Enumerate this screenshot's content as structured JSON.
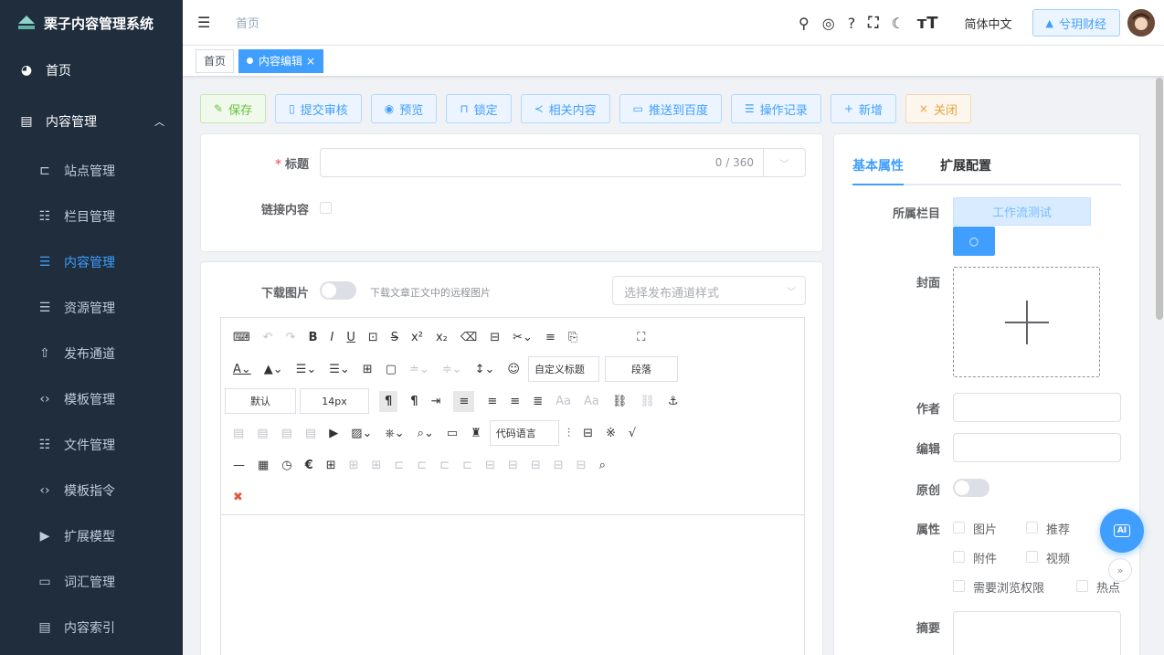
{
  "app": {
    "title": "栗子内容管理系统"
  },
  "sidebar": {
    "items": [
      {
        "label": "首页",
        "icon": "dashboard-icon"
      },
      {
        "label": "内容管理",
        "icon": "document-icon",
        "expanded": true
      },
      {
        "label": "站点管理",
        "icon": "site-icon"
      },
      {
        "label": "栏目管理",
        "icon": "catalog-icon"
      },
      {
        "label": "内容管理",
        "icon": "list-icon",
        "active": true
      },
      {
        "label": "资源管理",
        "icon": "list-icon"
      },
      {
        "label": "发布通道",
        "icon": "publish-icon"
      },
      {
        "label": "模板管理",
        "icon": "code-icon"
      },
      {
        "label": "文件管理",
        "icon": "catalog-icon"
      },
      {
        "label": "模板指令",
        "icon": "code-icon"
      },
      {
        "label": "扩展模型",
        "icon": "model-icon"
      },
      {
        "label": "词汇管理",
        "icon": "word-icon"
      },
      {
        "label": "内容索引",
        "icon": "document-icon"
      }
    ],
    "colors": {
      "bg": "#1f2d3d",
      "active": "#409eff"
    }
  },
  "header": {
    "breadcrumb": "首页",
    "language": "简体中文",
    "site_button": "兮玥财经"
  },
  "tags": {
    "home": "首页",
    "active": "内容编辑"
  },
  "toolbar": {
    "save": "保存",
    "submit": "提交审核",
    "preview": "预览",
    "lock": "锁定",
    "related": "相关内容",
    "push_baidu": "推送到百度",
    "log": "操作记录",
    "add": "新增",
    "close": "关闭"
  },
  "form": {
    "title_label": "标题",
    "title_required": "*",
    "title_counter": "0 / 360",
    "link_label": "链接内容",
    "download_label": "下载图片",
    "download_hint": "下载文章正文中的远程图片",
    "publish_style_placeholder": "选择发布通道样式"
  },
  "editor": {
    "custom_title": "自定义标题",
    "paragraph": "段落",
    "font_default": "默认",
    "font_size": "14px",
    "code_lang": "代码语言"
  },
  "right": {
    "tabs": [
      "基本属性",
      "扩展配置"
    ],
    "catalog_label": "所属栏目",
    "catalog_value": "工作流测试",
    "cover_label": "封面",
    "author_label": "作者",
    "editor_label": "编辑",
    "original_label": "原创",
    "attr_label": "属性",
    "attrs": [
      "图片",
      "推荐",
      "附件",
      "视频",
      "需要浏览权限",
      "热点"
    ],
    "summary_label": "摘要"
  },
  "fab": {
    "label": "AI"
  }
}
